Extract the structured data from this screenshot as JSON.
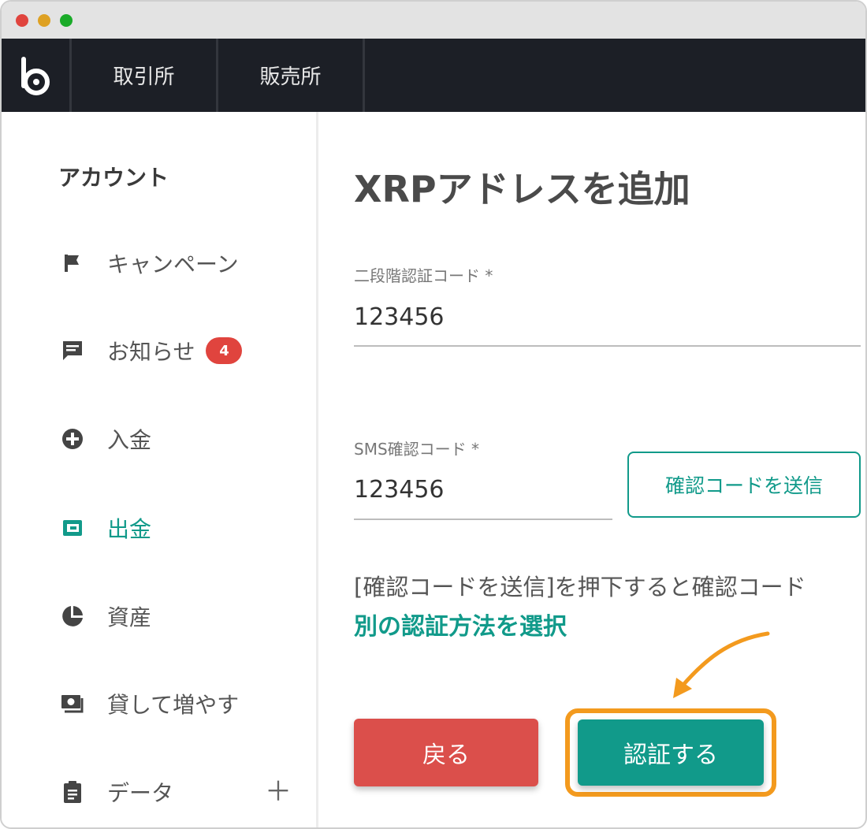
{
  "colors": {
    "accent": "#119a8a",
    "danger": "#db4f4b",
    "highlight": "#f39a1e",
    "nav_bg": "#1c1f26",
    "badge": "#e0443e"
  },
  "navbar": {
    "logo_icon": "bitbank-logo-icon",
    "tabs": [
      "取引所",
      "販売所"
    ]
  },
  "sidebar": {
    "heading": "アカウント",
    "items": [
      {
        "label": "キャンペーン",
        "icon": "flag-icon"
      },
      {
        "label": "お知らせ",
        "icon": "message-icon",
        "badge": "4"
      },
      {
        "label": "入金",
        "icon": "plus-circle-icon"
      },
      {
        "label": "出金",
        "icon": "wallet-icon",
        "active": true
      },
      {
        "label": "資産",
        "icon": "pie-chart-icon"
      },
      {
        "label": "貸して増やす",
        "icon": "money-icon"
      },
      {
        "label": "データ",
        "icon": "clipboard-icon",
        "expand": "＋"
      }
    ]
  },
  "main": {
    "title": "XRPアドレスを追加",
    "two_factor": {
      "label": "二段階認証コード *",
      "value": "123456"
    },
    "sms": {
      "label": "SMS確認コード *",
      "value": "123456",
      "send_label": "確認コードを送信"
    },
    "note": "[確認コードを送信]を押下すると確認コード",
    "alt_link": "別の認証方法を選択",
    "back_label": "戻る",
    "verify_label": "認証する"
  }
}
